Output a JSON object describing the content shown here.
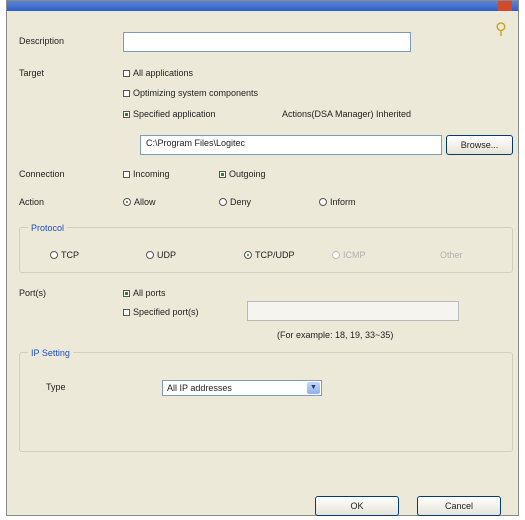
{
  "dialog": {
    "title": "",
    "help_icon": "help-icon"
  },
  "description": {
    "label": "Description",
    "value": ""
  },
  "target": {
    "label": "Target",
    "options": [
      "All applications",
      "Optimizing system components",
      "Specified application"
    ],
    "selected": 2,
    "alias_text": "Actions(DSA Manager) Inherited",
    "path_value": "C:\\Program Files\\Logitec",
    "browse_label": "Browse..."
  },
  "connection": {
    "label": "Connection",
    "options": [
      "Incoming",
      "Outgoing"
    ],
    "selected": 1
  },
  "action": {
    "label": "Action",
    "options": [
      "Allow",
      "Deny",
      "Inform"
    ],
    "selected": 0
  },
  "protocol": {
    "group_title": "Protocol",
    "options": [
      "TCP",
      "UDP",
      "TCP/UDP",
      "ICMP",
      "Other"
    ],
    "selected": 2
  },
  "port": {
    "label": "Port(s)",
    "all_label": "All ports",
    "specified_label": "Specified port(s)",
    "value": "",
    "example": "(For example: 18, 19, 33~35)"
  },
  "ip_setting": {
    "group_title": "IP Setting",
    "type_label": "Type",
    "type_value": "All IP addresses"
  },
  "buttons": {
    "ok": "OK",
    "cancel": "Cancel"
  }
}
